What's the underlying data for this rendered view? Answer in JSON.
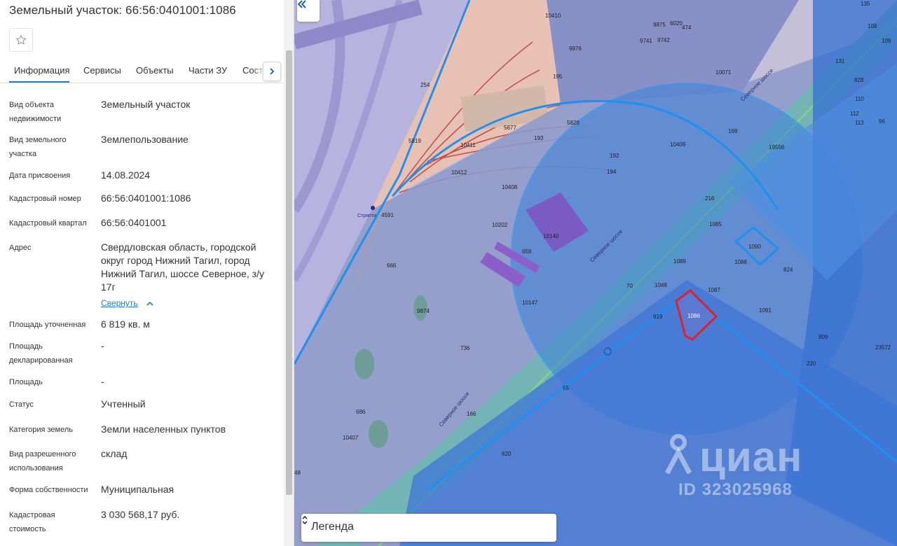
{
  "title": "Земельный участок: 66:56:0401001:1086",
  "tabs": [
    {
      "label": "Информация"
    },
    {
      "label": "Сервисы"
    },
    {
      "label": "Объекты"
    },
    {
      "label": "Части ЗУ"
    },
    {
      "label": "Соста"
    }
  ],
  "info": [
    {
      "label": "Вид объекта недвижимости",
      "value": "Земельный участок"
    },
    {
      "label": "Вид земельного участка",
      "value": "Землепользование"
    },
    {
      "label": "Дата присвоения",
      "value": "14.08.2024"
    },
    {
      "label": "Кадастровый номер",
      "value": "66:56:0401001:1086"
    },
    {
      "label": "Кадастровый квартал",
      "value": "66:56:0401001"
    },
    {
      "label": "Адрес",
      "value": "Свердловская область, городской округ город Нижний Тагил, город Нижний Тагил, шоссе Северное, з/у 17г"
    },
    {
      "label": "Площадь уточненная",
      "value": "6 819 кв. м"
    },
    {
      "label": "Площадь декларированная",
      "value": "-"
    },
    {
      "label": "Площадь",
      "value": "-"
    },
    {
      "label": "Статус",
      "value": "Учтенный"
    },
    {
      "label": "Категория земель",
      "value": "Земли населенных пунктов"
    },
    {
      "label": "Вид разрешенного использования",
      "value": "склад"
    },
    {
      "label": "Форма собственности",
      "value": "Муниципальная"
    },
    {
      "label": "Кадастровая стоимость",
      "value": "3 030 568,17 руб."
    }
  ],
  "address_collapse": "Свернуть",
  "map": {
    "legend_label": "Легенда",
    "watermark_brand": "циан",
    "watermark_id": "ID 323025968",
    "street_label": "Северное шоссе",
    "station_label": "Стряпти",
    "selected_plot": "1086",
    "plot_numbers": [
      "10410",
      "9875",
      "6020",
      "474",
      "9876",
      "9741",
      "9742",
      "10071",
      "135",
      "108",
      "109",
      "131",
      "828",
      "112",
      "113",
      "96",
      "110",
      "254",
      "195",
      "5677",
      "5829",
      "193",
      "10411",
      "10409",
      "169",
      "19556",
      "10412",
      "192",
      "194",
      "10408",
      "216",
      "5819",
      "4591",
      "10202",
      "10140",
      "1085",
      "1090",
      "659",
      "1089",
      "1088",
      "824",
      "666",
      "70",
      "1048",
      "1087",
      "10147",
      "9874",
      "919",
      "1091",
      "736",
      "809",
      "23572",
      "220",
      "686",
      "10407",
      "55",
      "166",
      "620",
      "48"
    ],
    "colors": {
      "selected": "#e0202e",
      "zone_border": "#1f8ff0",
      "accent": "#1f7cc2"
    }
  }
}
